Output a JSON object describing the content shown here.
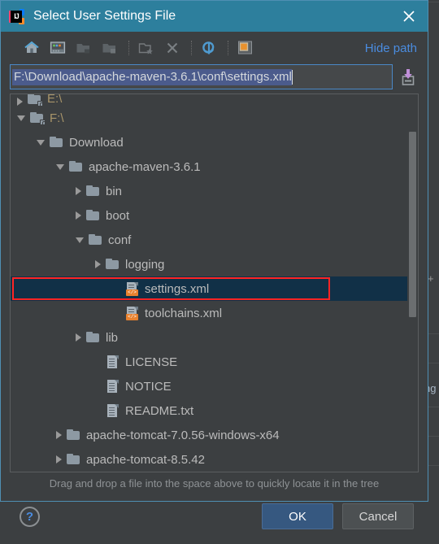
{
  "window": {
    "title": "Select User Settings File",
    "app_icon": "intellij-idea-icon",
    "icon_text": "IJ",
    "close_label": "✕",
    "title_bar_color": "#2d7f9d"
  },
  "toolbar": {
    "buttons": [
      {
        "name": "home-icon",
        "tooltip": "Home"
      },
      {
        "name": "desktop-icon",
        "tooltip": "Desktop"
      },
      {
        "name": "folder-up-icon",
        "tooltip": "Up"
      },
      {
        "name": "project-folder-icon",
        "tooltip": "Project Directory"
      },
      {
        "name": "new-folder-icon",
        "tooltip": "New Folder"
      },
      {
        "name": "delete-icon",
        "tooltip": "Delete"
      },
      {
        "name": "refresh-icon",
        "tooltip": "Refresh"
      },
      {
        "name": "show-hidden-icon",
        "tooltip": "Show Hidden Files"
      }
    ],
    "hide_path_label": "Hide path",
    "link_color": "#4a8ce0"
  },
  "path_field": {
    "value": "F:\\Download\\apache-maven-3.6.1\\conf\\settings.xml",
    "selected": true,
    "selection_color": "#4b5b8c",
    "border_color": "#4a88c7",
    "paste_icon": "paste-path-icon"
  },
  "tree": {
    "items": [
      {
        "label": "E:\\",
        "indent": 0,
        "arrow": "collapsed",
        "icon": "drive-folder",
        "kind": "drive",
        "partial": true,
        "selected": false
      },
      {
        "label": "F:\\",
        "indent": 0,
        "arrow": "expanded",
        "icon": "drive-folder",
        "kind": "drive",
        "partial": false,
        "selected": false
      },
      {
        "label": "Download",
        "indent": 1,
        "arrow": "expanded",
        "icon": "folder",
        "kind": "folder",
        "partial": false,
        "selected": false
      },
      {
        "label": "apache-maven-3.6.1",
        "indent": 2,
        "arrow": "expanded",
        "icon": "folder",
        "kind": "folder",
        "partial": false,
        "selected": false
      },
      {
        "label": "bin",
        "indent": 3,
        "arrow": "collapsed",
        "icon": "folder",
        "kind": "folder",
        "partial": false,
        "selected": false
      },
      {
        "label": "boot",
        "indent": 3,
        "arrow": "collapsed",
        "icon": "folder",
        "kind": "folder",
        "partial": false,
        "selected": false
      },
      {
        "label": "conf",
        "indent": 3,
        "arrow": "expanded",
        "icon": "folder",
        "kind": "folder",
        "partial": false,
        "selected": false
      },
      {
        "label": "logging",
        "indent": 4,
        "arrow": "collapsed",
        "icon": "folder",
        "kind": "folder",
        "partial": false,
        "selected": false
      },
      {
        "label": "settings.xml",
        "indent": 5,
        "arrow": "none",
        "icon": "xml-file",
        "kind": "file",
        "partial": false,
        "selected": true,
        "highlight_box": true
      },
      {
        "label": "toolchains.xml",
        "indent": 5,
        "arrow": "none",
        "icon": "xml-file",
        "kind": "file",
        "partial": false,
        "selected": false
      },
      {
        "label": "lib",
        "indent": 3,
        "arrow": "collapsed",
        "icon": "folder",
        "kind": "folder",
        "partial": false,
        "selected": false
      },
      {
        "label": "LICENSE",
        "indent": 4,
        "arrow": "none",
        "icon": "text-file",
        "kind": "file",
        "partial": false,
        "selected": false
      },
      {
        "label": "NOTICE",
        "indent": 4,
        "arrow": "none",
        "icon": "text-file",
        "kind": "file",
        "partial": false,
        "selected": false
      },
      {
        "label": "README.txt",
        "indent": 4,
        "arrow": "none",
        "icon": "text-file",
        "kind": "file",
        "partial": false,
        "selected": false
      },
      {
        "label": "apache-tomcat-7.0.56-windows-x64",
        "indent": 2,
        "arrow": "collapsed",
        "icon": "folder",
        "kind": "folder",
        "partial": false,
        "selected": false
      },
      {
        "label": "apache-tomcat-8.5.42",
        "indent": 2,
        "arrow": "collapsed",
        "icon": "folder",
        "kind": "folder",
        "partial": false,
        "selected": false
      }
    ],
    "selection_color": "#113047",
    "highlight_box_color": "#ff2424",
    "scrollbar": {
      "thumb_top_pct": 10,
      "thumb_height_pct": 49
    }
  },
  "hint": {
    "text": "Drag and drop a file into the space above to quickly locate it in the tree"
  },
  "footer": {
    "help_label": "?",
    "ok_label": "OK",
    "cancel_label": "Cancel",
    "ok_color": "#365880"
  }
}
